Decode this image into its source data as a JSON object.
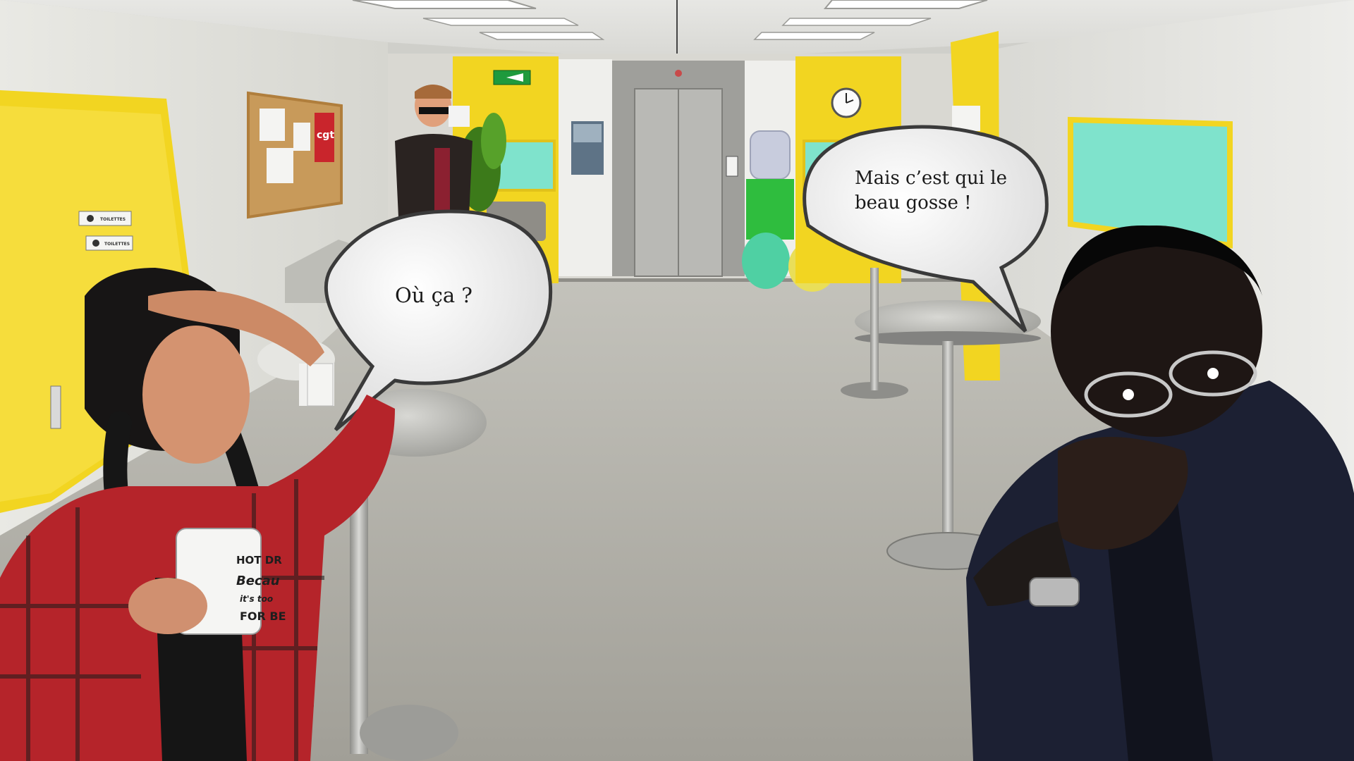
{
  "speech_bubbles": {
    "left": "Où ça ?",
    "right": "Mais c’est qui le\nbeau gosse !"
  },
  "signs": {
    "restroom_top": "TOILETTES",
    "restroom_bottom": "TOILETTES",
    "union_poster": "cgt"
  },
  "mug_print": [
    "HOT DR",
    "Becau",
    "it's too",
    "FOR BE"
  ],
  "colors": {
    "door_yellow": "#f2d521",
    "panel_teal": "#7fe3cc",
    "shirt_red": "#b5242a",
    "floor_grey": "#a9a89f",
    "jacket_navy": "#1c2033"
  }
}
